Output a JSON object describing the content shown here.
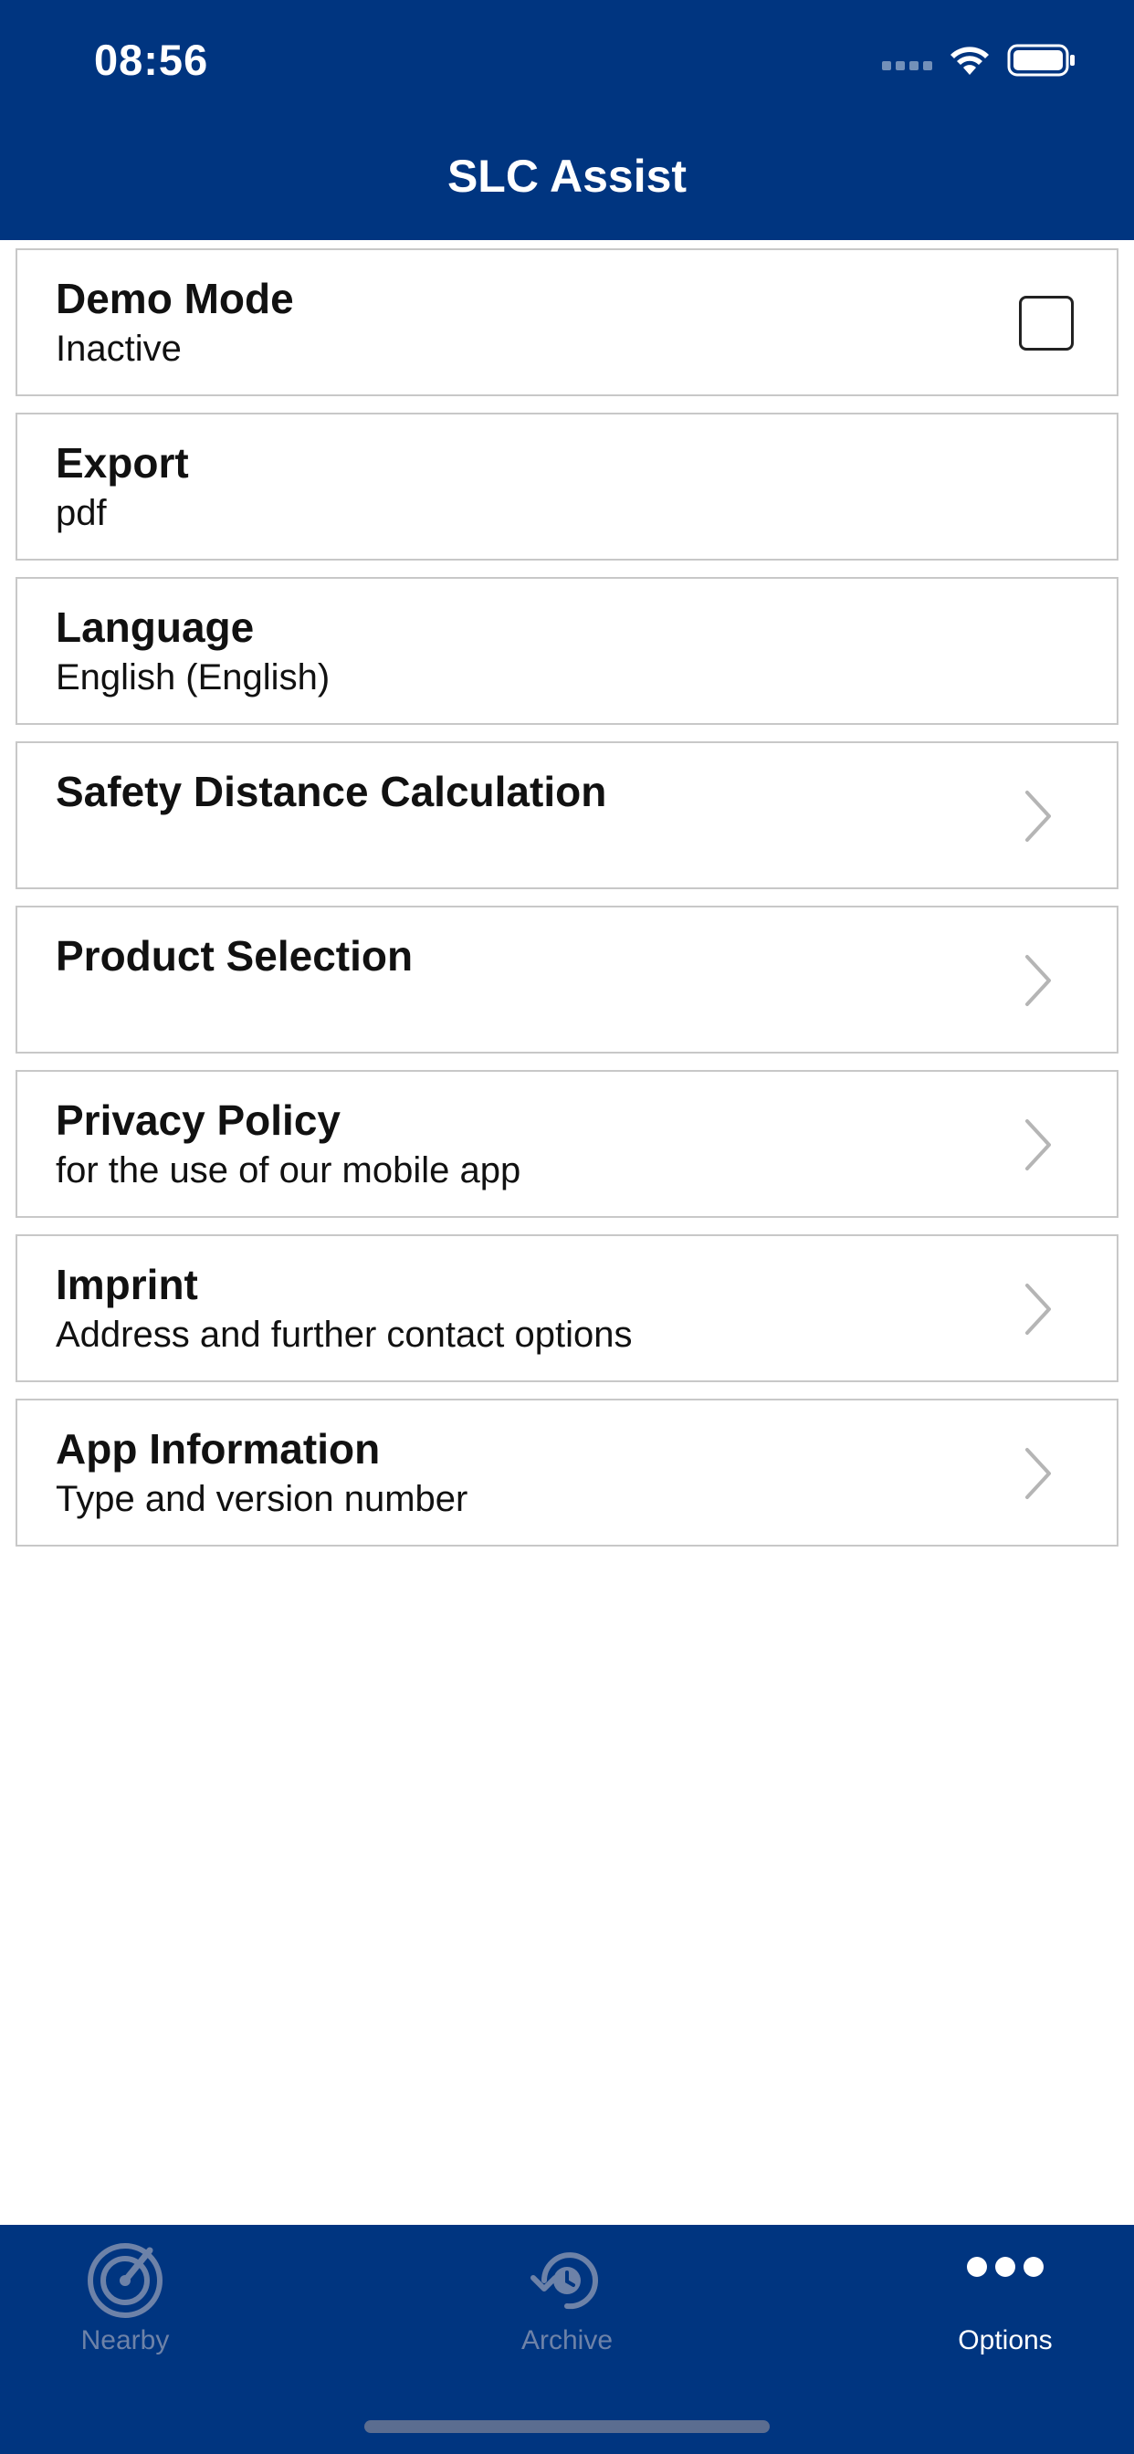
{
  "status_bar": {
    "time": "08:56"
  },
  "header": {
    "title": "SLC Assist"
  },
  "settings": [
    {
      "title": "Demo Mode",
      "subtitle": "Inactive",
      "control": "checkbox",
      "checked": false
    },
    {
      "title": "Export",
      "subtitle": "pdf",
      "control": "none"
    },
    {
      "title": "Language",
      "subtitle": "English (English)",
      "control": "none"
    },
    {
      "title": "Safety Distance Calculation",
      "subtitle": "",
      "control": "chevron-right-icon"
    },
    {
      "title": "Product Selection",
      "subtitle": "",
      "control": "chevron-right-icon"
    },
    {
      "title": "Privacy Policy",
      "subtitle": "for the use of our mobile app",
      "control": "chevron-right-icon"
    },
    {
      "title": "Imprint",
      "subtitle": "Address and further contact options",
      "control": "chevron-right-icon"
    },
    {
      "title": "App Information",
      "subtitle": "Type and version number",
      "control": "chevron-right-icon"
    }
  ],
  "tabbar": {
    "tabs": [
      {
        "label": "Nearby",
        "icon": "radar-icon",
        "active": false
      },
      {
        "label": "Archive",
        "icon": "history-icon",
        "active": false
      },
      {
        "label": "Options",
        "icon": "more-dots-icon",
        "active": true
      }
    ]
  },
  "colors": {
    "brand": "#003580",
    "inactive_tab": "#6d82a8",
    "border": "#c8c8c8"
  }
}
